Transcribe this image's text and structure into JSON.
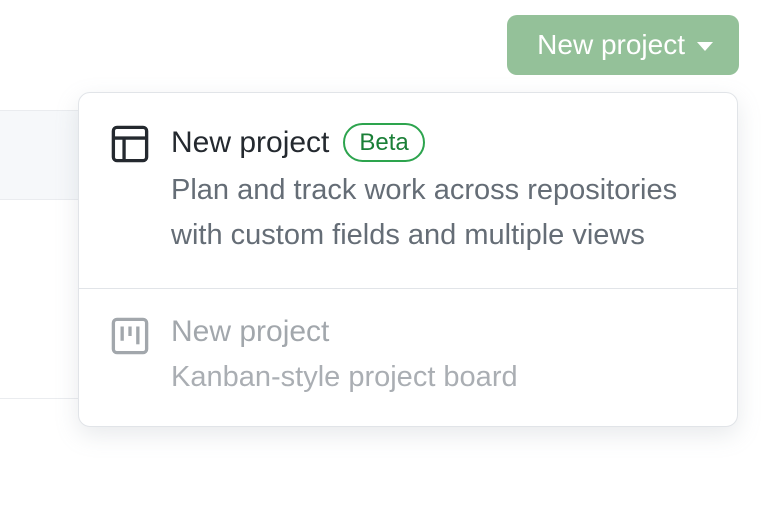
{
  "button": {
    "label": "New project"
  },
  "dropdown": {
    "items": [
      {
        "title": "New project",
        "badge": "Beta",
        "description": "Plan and track work across repositories with custom fields and multiple views"
      },
      {
        "title": "New project",
        "description": "Kanban-style project board"
      }
    ]
  }
}
